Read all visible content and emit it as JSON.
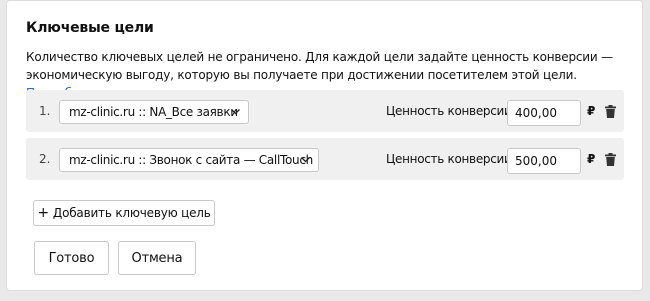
{
  "section": {
    "title": "Ключевые цели",
    "description": "Количество ключевых целей не ограничено. Для каждой цели задайте ценность конверсии — экономическую выгоду, которую вы получаете при достижении посетителем этой цели.",
    "more_link": "Подробнее"
  },
  "goals": [
    {
      "index": "1.",
      "goal": "mz-clinic.ru :: NA_Все заявки",
      "conversion_label": "Ценность конверсии",
      "value": "400,00",
      "currency": "₽"
    },
    {
      "index": "2.",
      "goal": "mz-clinic.ru :: Звонок с сайта — CallTouch",
      "conversion_label": "Ценность конверсии",
      "value": "500,00",
      "currency": "₽"
    }
  ],
  "buttons": {
    "add_goal": "Добавить ключевую цель",
    "add_icon": "+",
    "done": "Готово",
    "cancel": "Отмена"
  },
  "icons": {
    "dropdown": "chevron-down-icon",
    "delete": "trash-icon"
  },
  "colors": {
    "link": "#1a6fdb",
    "row_background": "#f0f0f0"
  }
}
